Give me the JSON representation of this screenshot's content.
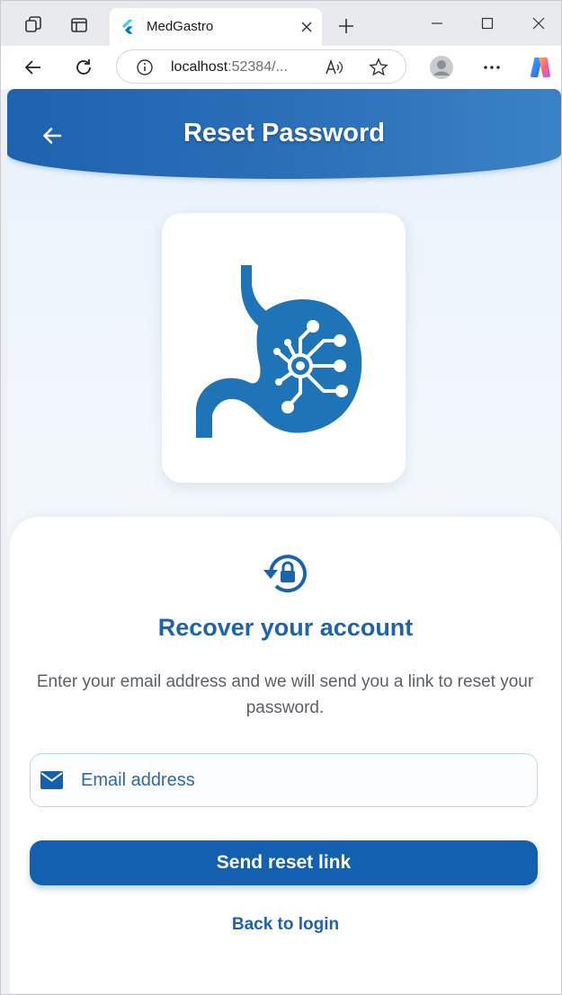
{
  "browser": {
    "tab_title": "MedGastro",
    "url_host": "localhost",
    "url_rest": ":52384/...",
    "icons": [
      "tab-actions-icon",
      "vertical-tabs-icon",
      "flutter-favicon",
      "close-icon",
      "plus-icon",
      "minimize-icon",
      "maximize-icon",
      "window-close-icon",
      "back-arrow-icon",
      "refresh-icon",
      "info-icon",
      "read-aloud-icon",
      "favorite-star-icon",
      "profile-avatar-icon",
      "more-options-icon",
      "copilot-icon"
    ]
  },
  "appbar": {
    "title": "Reset Password",
    "back_icon": "back-arrow-icon"
  },
  "logo": {
    "icon": "stomach-circuit-logo"
  },
  "form": {
    "icon": "lock-reset-icon",
    "title": "Recover your account",
    "description": "Enter your email address and we will send you a link to reset your password.",
    "email_placeholder": "Email address",
    "email_icon": "mail-icon",
    "submit_label": "Send reset link",
    "back_link": "Back to login"
  },
  "colors": {
    "primary": "#1460b0",
    "appbar_gradient_start": "#1e63b0",
    "appbar_gradient_end": "#3a82c6",
    "logo_blue": "#1f73b7",
    "text_secondary": "#5b5f66",
    "field_border": "#b8dcef"
  }
}
